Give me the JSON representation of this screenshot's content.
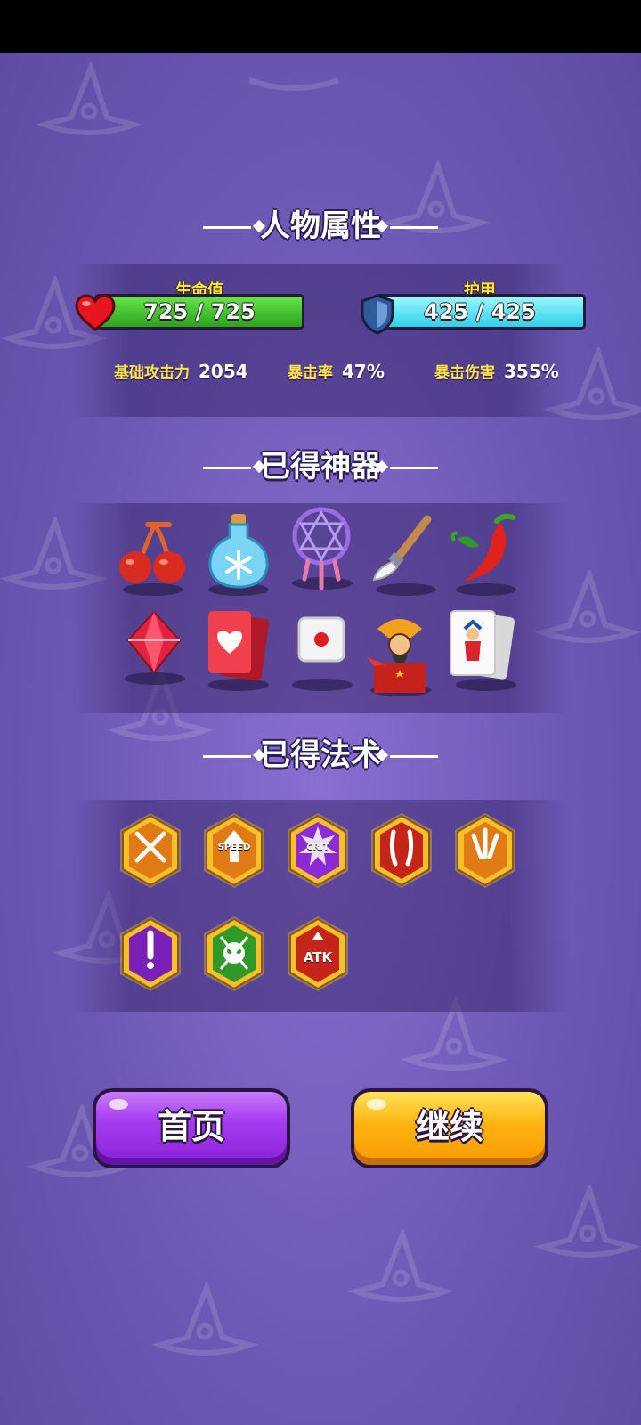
{
  "sections": {
    "attributes_title": "人物属性",
    "artifacts_title": "已得神器",
    "spells_title": "已得法术"
  },
  "health": {
    "label": "生命值",
    "value": "725 / 725",
    "current": 725,
    "max": 725,
    "color": "#37c42a",
    "icon": "heart-icon"
  },
  "armor": {
    "label": "护甲",
    "value": "425 / 425",
    "current": 425,
    "max": 425,
    "color": "#3fe0f2",
    "icon": "shield-icon"
  },
  "stats": [
    {
      "label": "基础攻击力",
      "value": "2054"
    },
    {
      "label": "暴击率",
      "value": "47%"
    },
    {
      "label": "暴击伤害",
      "value": "355%"
    }
  ],
  "artifacts": [
    {
      "icon": "cherry-icon"
    },
    {
      "icon": "frost-potion-icon"
    },
    {
      "icon": "dreamcatcher-icon"
    },
    {
      "icon": "paintbrush-icon"
    },
    {
      "icon": "chili-pepper-icon"
    },
    {
      "icon": "red-gem-icon"
    },
    {
      "icon": "heart-card-icon"
    },
    {
      "icon": "dice-icon"
    },
    {
      "icon": "jack-in-the-box-icon"
    },
    {
      "icon": "joker-card-icon"
    }
  ],
  "spells": [
    {
      "icon": "crossed-swords-spell-icon",
      "inner": ""
    },
    {
      "icon": "speed-spell-icon",
      "inner": "SPEED"
    },
    {
      "icon": "crit-spell-icon",
      "inner": "CRIT"
    },
    {
      "icon": "twin-claw-spell-icon",
      "inner": ""
    },
    {
      "icon": "triple-shot-spell-icon",
      "inner": ""
    },
    {
      "icon": "poison-drop-spell-icon",
      "inner": ""
    },
    {
      "icon": "skull-spell-icon",
      "inner": ""
    },
    {
      "icon": "atk-boost-spell-icon",
      "inner": "ATK"
    }
  ],
  "buttons": {
    "home_label": "首页",
    "home_color": "#a53cf0",
    "continue_label": "继续",
    "continue_color": "#ffb20f"
  }
}
